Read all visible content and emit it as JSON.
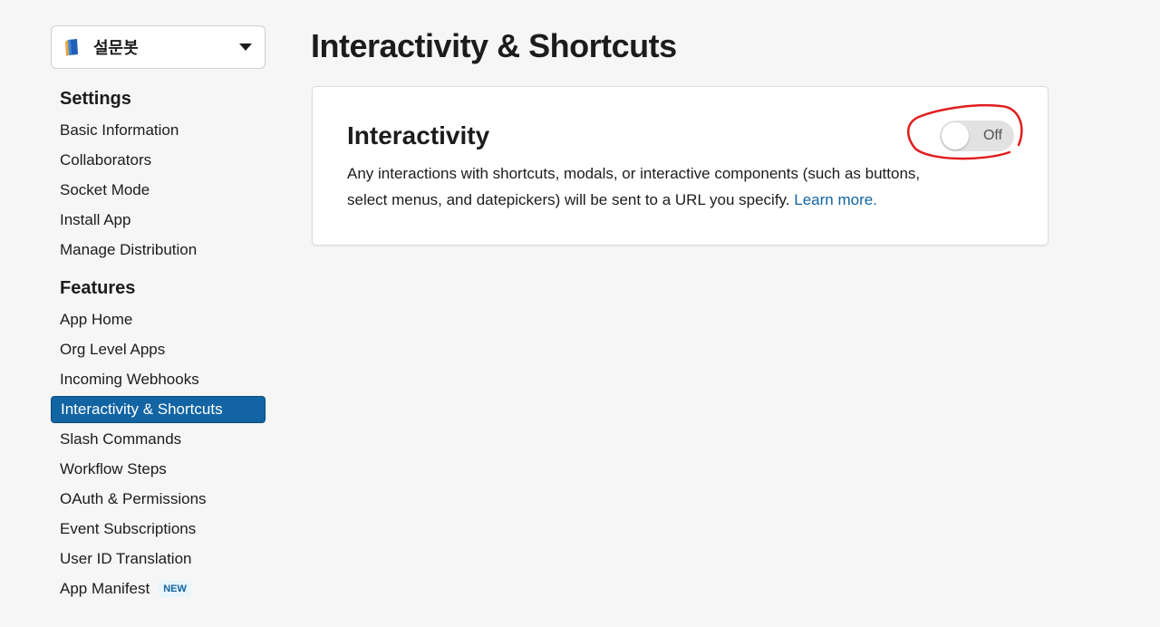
{
  "app_selector": {
    "name": "설문봇",
    "icon": "notebook-icon"
  },
  "sections": [
    {
      "title": "Settings",
      "items": [
        {
          "label": "Basic Information"
        },
        {
          "label": "Collaborators"
        },
        {
          "label": "Socket Mode"
        },
        {
          "label": "Install App"
        },
        {
          "label": "Manage Distribution"
        }
      ]
    },
    {
      "title": "Features",
      "items": [
        {
          "label": "App Home"
        },
        {
          "label": "Org Level Apps"
        },
        {
          "label": "Incoming Webhooks"
        },
        {
          "label": "Interactivity & Shortcuts",
          "active": true
        },
        {
          "label": "Slash Commands"
        },
        {
          "label": "Workflow Steps"
        },
        {
          "label": "OAuth & Permissions"
        },
        {
          "label": "Event Subscriptions"
        },
        {
          "label": "User ID Translation"
        },
        {
          "label": "App Manifest",
          "badge": "NEW"
        }
      ]
    }
  ],
  "page": {
    "title": "Interactivity & Shortcuts",
    "card": {
      "title": "Interactivity",
      "description": "Any interactions with shortcuts, modals, or interactive components (such as buttons, select menus, and datepickers) will be sent to a URL you specify.",
      "link_text": "Learn more.",
      "toggle_label": "Off",
      "toggle_on": false
    }
  },
  "colors": {
    "accent": "#1264a3",
    "annotation": "#e01e1e",
    "background": "#f6f6f6"
  }
}
